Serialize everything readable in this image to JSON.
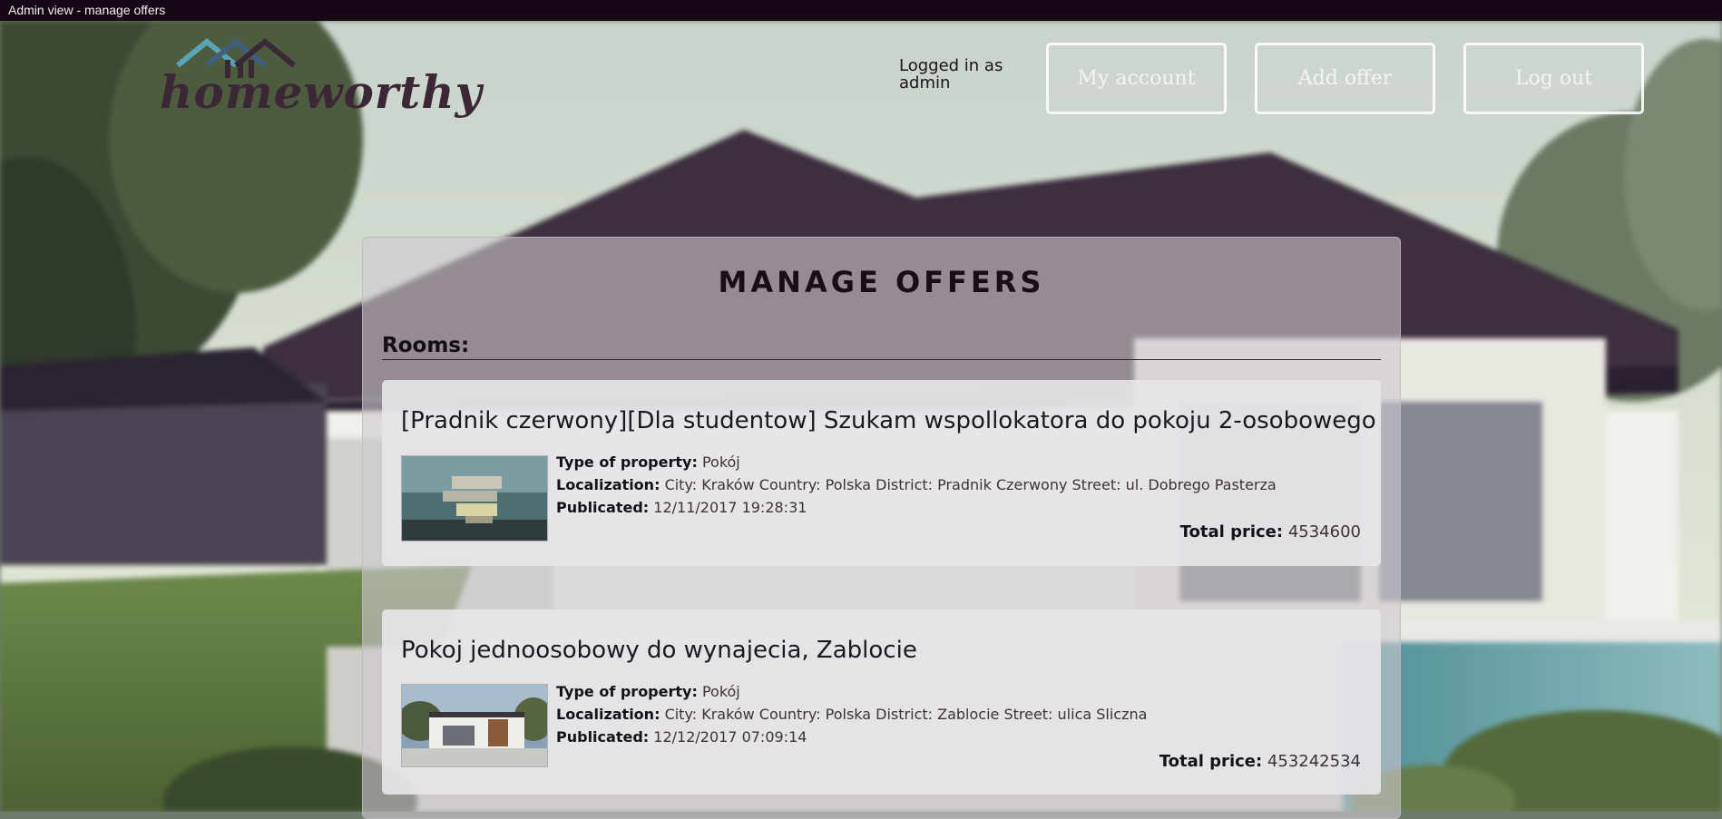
{
  "window": {
    "title": "Admin view - manage offers"
  },
  "brand": {
    "logo_text": "homeworthy"
  },
  "header": {
    "logged_in_label": "Logged in as",
    "logged_in_user": "admin",
    "my_account": "My account",
    "add_offer": "Add offer",
    "log_out": "Log out"
  },
  "page": {
    "title": "MANAGE OFFERS",
    "section": "Rooms:"
  },
  "labels": {
    "type": "Type of property:",
    "localization": "Localization:",
    "publicated": "Publicated:",
    "total_price": "Total price:"
  },
  "offers": [
    {
      "title": "[Pradnik czerwony][Dla studentow] Szukam wspollokatora do pokoju 2-osobowego",
      "type": "Pokój",
      "localization": "City: Kraków Country: Polska District: Pradnik Czerwony Street: ul. Dobrego Pasterza",
      "publicated": "12/11/2017 19:28:31",
      "total_price": "4534600"
    },
    {
      "title": "Pokoj jednoosobowy do wynajecia, Zablocie",
      "type": "Pokój",
      "localization": "City: Kraków Country: Polska District: Zablocie Street: ulica Sliczna",
      "publicated": "12/12/2017 07:09:14",
      "total_price": "453242534"
    }
  ],
  "colors": {
    "titlebar": "#170815",
    "accent_dark": "#3b2736",
    "panel": "#cecad0"
  }
}
